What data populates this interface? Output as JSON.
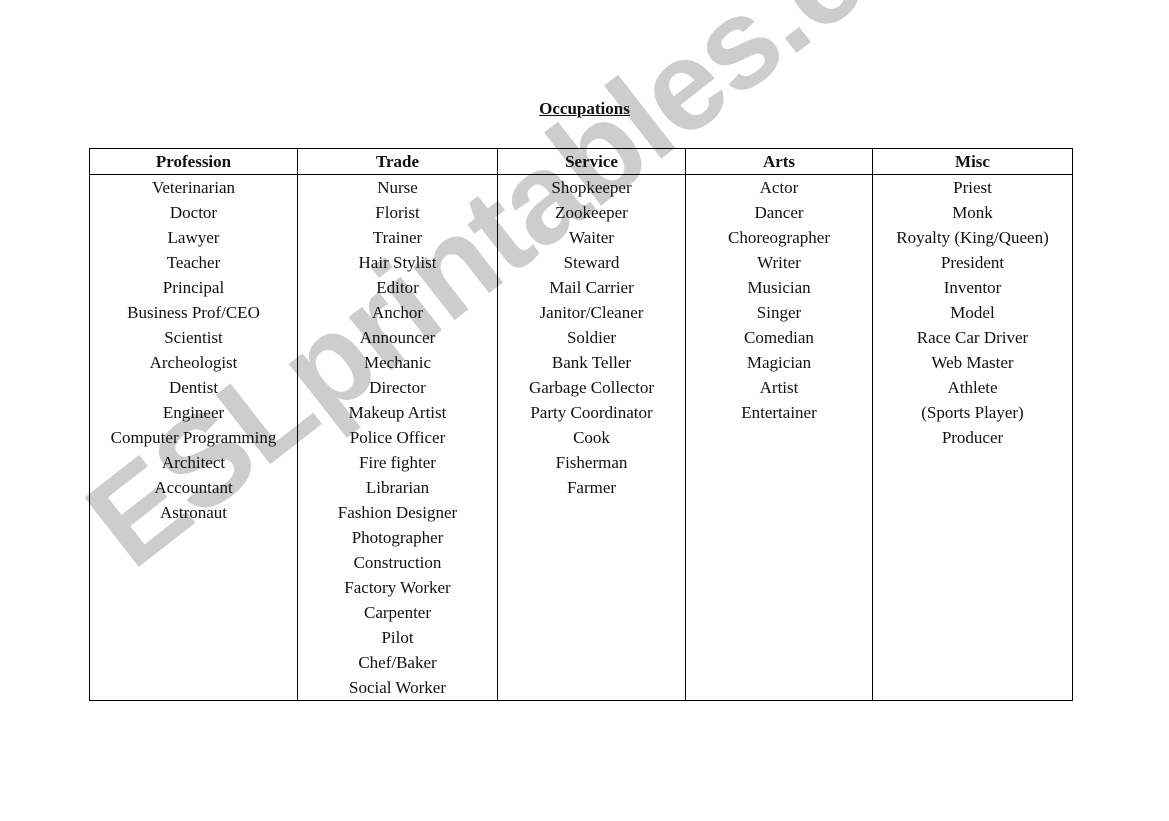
{
  "document": {
    "title": "Occupations",
    "watermark": "ESLprintables.com"
  },
  "table": {
    "headers": [
      "Profession",
      "Trade",
      "Service",
      "Arts",
      "Misc"
    ],
    "columns": [
      [
        "Veterinarian",
        "Doctor",
        "Lawyer",
        "Teacher",
        "Principal",
        "Business Prof/CEO",
        "Scientist",
        "Archeologist",
        "Dentist",
        "Engineer",
        "Computer Programming",
        "Architect",
        "Accountant",
        "Astronaut"
      ],
      [
        "Nurse",
        "Florist",
        "Trainer",
        "Hair Stylist",
        "Editor",
        "Anchor",
        "Announcer",
        "Mechanic",
        "Director",
        "Makeup Artist",
        "Police Officer",
        "Fire fighter",
        "Librarian",
        "Fashion Designer",
        "Photographer",
        "Construction",
        "Factory Worker",
        "Carpenter",
        "Pilot",
        "Chef/Baker",
        "Social Worker"
      ],
      [
        "Shopkeeper",
        "Zookeeper",
        "Waiter",
        "Steward",
        "Mail Carrier",
        "Janitor/Cleaner",
        "Soldier",
        "Bank Teller",
        "Garbage Collector",
        "Party Coordinator",
        "Cook",
        "Fisherman",
        "Farmer"
      ],
      [
        "Actor",
        "Dancer",
        "Choreographer",
        "Writer",
        "Musician",
        "Singer",
        "Comedian",
        "Magician",
        "Artist",
        "Entertainer"
      ],
      [
        "Priest",
        "Monk",
        "Royalty (King/Queen)",
        "President",
        "Inventor",
        "Model",
        "Race Car Driver",
        "Web Master",
        "Athlete",
        "(Sports Player)",
        "Producer"
      ]
    ]
  }
}
